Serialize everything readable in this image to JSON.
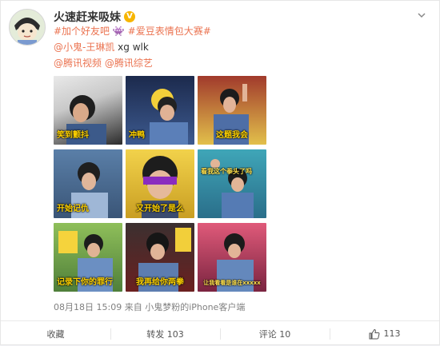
{
  "post": {
    "author": "火速赶来吸妹",
    "text": {
      "tag1": "#加个好友吧",
      "emoji": "👾",
      "tag2": "#爱豆表情包大赛#",
      "mention1": "@小鬼-王琳凯",
      "extra": " xg wlk",
      "mention2": "@腾讯视频",
      "mention3": "@腾讯综艺"
    },
    "images": [
      {
        "caption": "笑到颤抖"
      },
      {
        "caption": "冲鸭"
      },
      {
        "caption": "这题我会"
      },
      {
        "caption": "开始记仇"
      },
      {
        "caption": "又开始了是么"
      },
      {
        "caption": "看我这个拳头了吗"
      },
      {
        "caption": "记录下你的罪行"
      },
      {
        "caption": "我再给你两拳"
      },
      {
        "caption": "让我看看是谁在xxxxx"
      }
    ],
    "meta": {
      "date": "08月18日 15:09",
      "source": "来自 小鬼梦粉的iPhone客户端"
    }
  },
  "actions": {
    "favorite": "收藏",
    "repost": "转发 103",
    "comment": "评论 10",
    "like": "113"
  },
  "colors": {
    "accent": "#eb7350",
    "verify": "#f7b500",
    "text": "#333333"
  }
}
